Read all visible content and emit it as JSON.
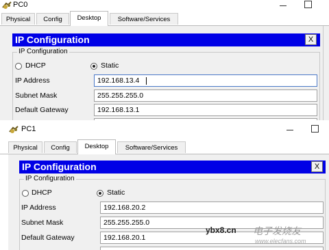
{
  "windows": [
    {
      "title": "PC0",
      "tabs": [
        "Physical",
        "Config",
        "Desktop",
        "Software/Services"
      ],
      "active_tab": "Desktop",
      "ip_config": {
        "header": "IP Configuration",
        "close_label": "X",
        "group_title": "IP Configuration",
        "dhcp_label": "DHCP",
        "static_label": "Static",
        "selected_mode": "Static",
        "ip_label": "IP Address",
        "ip_value": "192.168.13.4",
        "mask_label": "Subnet Mask",
        "mask_value": "255.255.255.0",
        "gateway_label": "Default Gateway",
        "gateway_value": "192.168.13.1"
      }
    },
    {
      "title": "PC1",
      "tabs": [
        "Physical",
        "Config",
        "Desktop",
        "Software/Services"
      ],
      "active_tab": "Desktop",
      "ip_config": {
        "header": "IP Configuration",
        "close_label": "X",
        "group_title": "IP Configuration",
        "dhcp_label": "DHCP",
        "static_label": "Static",
        "selected_mode": "Static",
        "ip_label": "IP Address",
        "ip_value": "192.168.20.2",
        "mask_label": "Subnet Mask",
        "mask_value": "255.255.255.0",
        "gateway_label": "Default Gateway",
        "gateway_value": "192.168.20.1"
      }
    }
  ],
  "watermark": {
    "site": "ybx8.cn",
    "brand_cn": "电子发烧友",
    "url": "www.elecfans.com"
  },
  "icons": {
    "app_icon": "pc-icon",
    "close": "close-icon",
    "minimize": "minimize-icon",
    "maximize": "maximize-icon"
  }
}
